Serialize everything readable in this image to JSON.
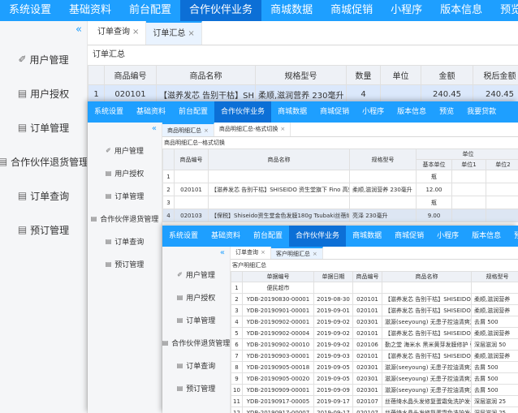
{
  "nav_items": [
    "系统设置",
    "基础资料",
    "前台配置",
    "合作伙伴业务",
    "商城数据",
    "商城促销",
    "小程序",
    "版本信息",
    "预览",
    "我要贷款"
  ],
  "collapse_glyph": "«",
  "w1": {
    "menu": [
      {
        "icon": "✐",
        "label": "用户管理"
      },
      {
        "icon": "▤",
        "label": "用户授权"
      },
      {
        "icon": "▤",
        "label": "订单管理"
      },
      {
        "icon": "▤",
        "label": "合作伙伴退货管理"
      },
      {
        "icon": "▤",
        "label": "订单查询"
      },
      {
        "icon": "▤",
        "label": "预订管理"
      }
    ],
    "tabs": [
      {
        "label": "订单查询"
      },
      {
        "label": "订单汇总"
      }
    ],
    "page_title": "订单汇总",
    "table": {
      "headers": [
        "",
        "商品编号",
        "商品名称",
        "规格型号",
        "数量",
        "单位",
        "金额",
        "税后金额"
      ],
      "rows": [
        [
          "1",
          "020101",
          "【滋养发芯 告别干枯】SHISEIDO 资生堂",
          "柔顺,滋润营养 230毫升",
          "4",
          "",
          "240.45",
          "240.45"
        ]
      ]
    }
  },
  "w2": {
    "menu": [
      {
        "icon": "✐",
        "label": "用户管理"
      },
      {
        "icon": "▤",
        "label": "用户授权"
      },
      {
        "icon": "▤",
        "label": "订单管理"
      },
      {
        "icon": "▤",
        "label": "合作伙伴退货管理"
      },
      {
        "icon": "▤",
        "label": "订单查询"
      },
      {
        "icon": "▤",
        "label": "预订管理"
      }
    ],
    "tabs": [
      {
        "label": "商品明细汇总"
      },
      {
        "label": "商品明细汇总-格式切换"
      }
    ],
    "page_title": "商品明细汇总--格式切换",
    "table": {
      "group_header": "单位",
      "headers": [
        "",
        "商品编号",
        "商品名称",
        "规格型号",
        "基本单位",
        "单位1",
        "单位2"
      ],
      "rows": [
        [
          "1",
          "",
          "",
          "",
          "瓶",
          "",
          ""
        ],
        [
          "2",
          "020101",
          "【滋养发芯 告别干枯】SHISEIDO 资生堂旗下 Fino 高效渗润修",
          "柔顺,滋润营养 230毫升",
          "12.00",
          "",
          ""
        ],
        [
          "3",
          "",
          "",
          "",
          "瓶",
          "",
          ""
        ],
        [
          "4",
          "020103",
          "【保税】Shiseido资生堂金色发膜180g Tsubaki丝蓓绮0秒修复",
          "亮泽 230毫升",
          "9.00",
          "",
          ""
        ]
      ]
    }
  },
  "w3": {
    "menu": [
      {
        "icon": "✐",
        "label": "用户管理"
      },
      {
        "icon": "▤",
        "label": "用户授权"
      },
      {
        "icon": "▤",
        "label": "订单管理"
      },
      {
        "icon": "▤",
        "label": "合作伙伴退货管理"
      },
      {
        "icon": "▤",
        "label": "订单查询"
      },
      {
        "icon": "▤",
        "label": "预订管理"
      }
    ],
    "tabs": [
      {
        "label": "订单查询"
      },
      {
        "label": "客户明细汇总"
      }
    ],
    "page_title": "客户明细汇总",
    "table": {
      "headers": [
        "",
        "单据编号",
        "单据日期",
        "商品编号",
        "商品名称",
        "规格型号"
      ],
      "rows": [
        [
          "1",
          "便民超市",
          "",
          "",
          "",
          ""
        ],
        [
          "2",
          "YDB-20190830-00001",
          "2019-08-30",
          "020101",
          "【滋养发芯 告别干枯】SHISEIDO 资",
          "柔顺,滋润营养"
        ],
        [
          "3",
          "YDB-20190901-00001",
          "2019-09-01",
          "020101",
          "【滋养发芯 告别干枯】SHISEIDO 资",
          "柔顺,滋润营养"
        ],
        [
          "4",
          "YDB-20190902-00001",
          "2019-09-02",
          "020301",
          "滋源(seeyoung) 无患子控油清爽洗",
          "去屑 500"
        ],
        [
          "5",
          "YDB-20190902-00004",
          "2019-09-02",
          "020101",
          "【滋养发芯 告别干枯】SHISEIDO 资",
          "柔顺,滋润营养"
        ],
        [
          "6",
          "YDB-20190902-00010",
          "2019-09-02",
          "020106",
          "勤之堂 海米水 黑米黄芽发膜修护 强",
          "深层滋润 50"
        ],
        [
          "7",
          "YDB-20190903-00001",
          "2019-09-03",
          "020101",
          "【滋养发芯 告别干枯】SHISEIDO 资",
          "柔顺,滋润营养"
        ],
        [
          "8",
          "YDB-20190905-00018",
          "2019-09-05",
          "020301",
          "滋源(seeyoung) 无患子控油清爽洗",
          "去屑 500"
        ],
        [
          "9",
          "YDB-20190905-00020",
          "2019-09-05",
          "020301",
          "滋源(seeyoung) 无患子控油清爽洗",
          "去屑 500"
        ],
        [
          "10",
          "YDB-20190909-00001",
          "2019-09-09",
          "020301",
          "滋源(seeyoung) 无患子控油清爽洗",
          "去屑 500"
        ],
        [
          "11",
          "YDB-20190917-00005",
          "2019-09-17",
          "020107",
          "丝蓓绮水晶头发修复蛋霜免洗护发干",
          "深层滋润 25"
        ],
        [
          "12",
          "YDB-20190917-00007",
          "2019-09-17",
          "020107",
          "丝蓓绮水晶头发修复蛋霜免洗护发干",
          "深层滋润 25"
        ],
        [
          "13",
          "YDB-20190917-00015",
          "2019-09-17",
          "020107",
          "丝蓓绮水晶头发修复蛋霜免洗护发干",
          "深层滋润 25"
        ]
      ]
    }
  }
}
